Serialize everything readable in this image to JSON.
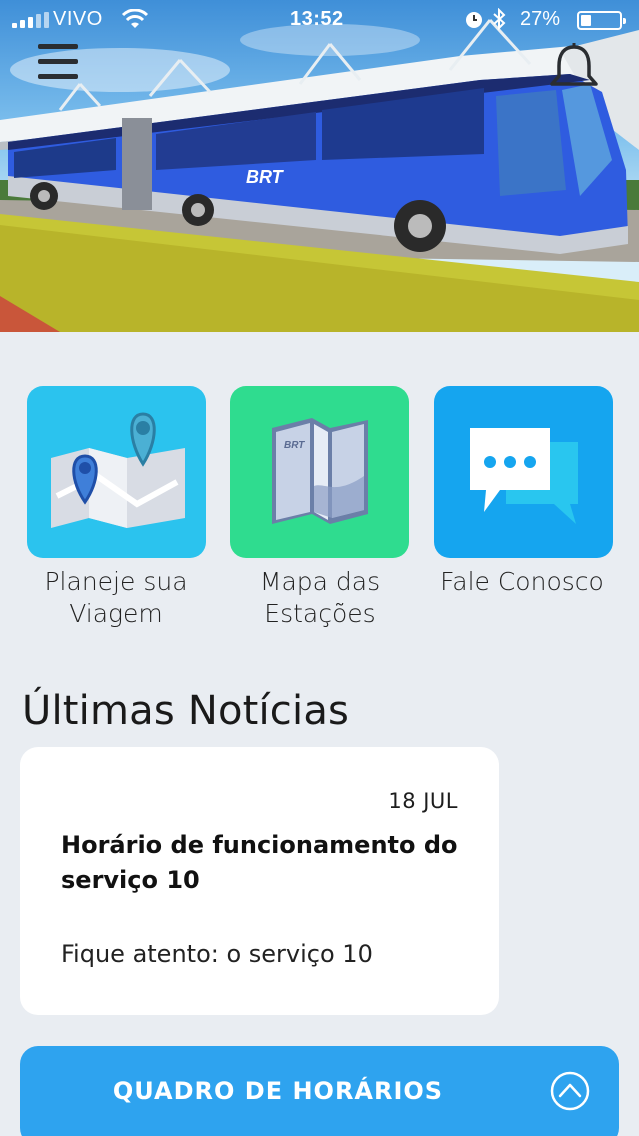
{
  "status_bar": {
    "carrier": "VIVO",
    "time": "13:52",
    "battery_percent": "27%",
    "battery_level": 0.27
  },
  "header": {
    "menu_icon": "hamburger-menu-icon",
    "notification_icon": "bell-icon",
    "hero_image_text": "BRT"
  },
  "tiles": [
    {
      "label": "Planeje sua Viagem",
      "icon": "map-pins-icon",
      "color": "#2bc3ee"
    },
    {
      "label": "Mapa das Estações",
      "icon": "folded-map-icon",
      "color": "#2fdc8f"
    },
    {
      "label": "Fale Conosco",
      "icon": "chat-bubbles-icon",
      "color": "#15a5ef"
    }
  ],
  "news": {
    "heading": "Últimas Notícias",
    "items": [
      {
        "date": "18 JUL",
        "title": "Horário de funcionamento do serviço 10",
        "excerpt": "Fique atento: o serviço 10"
      }
    ]
  },
  "schedule": {
    "label": "QUADRO DE HORÁRIOS",
    "icon": "chevron-up-circle-icon",
    "color": "#2ea3ef"
  }
}
